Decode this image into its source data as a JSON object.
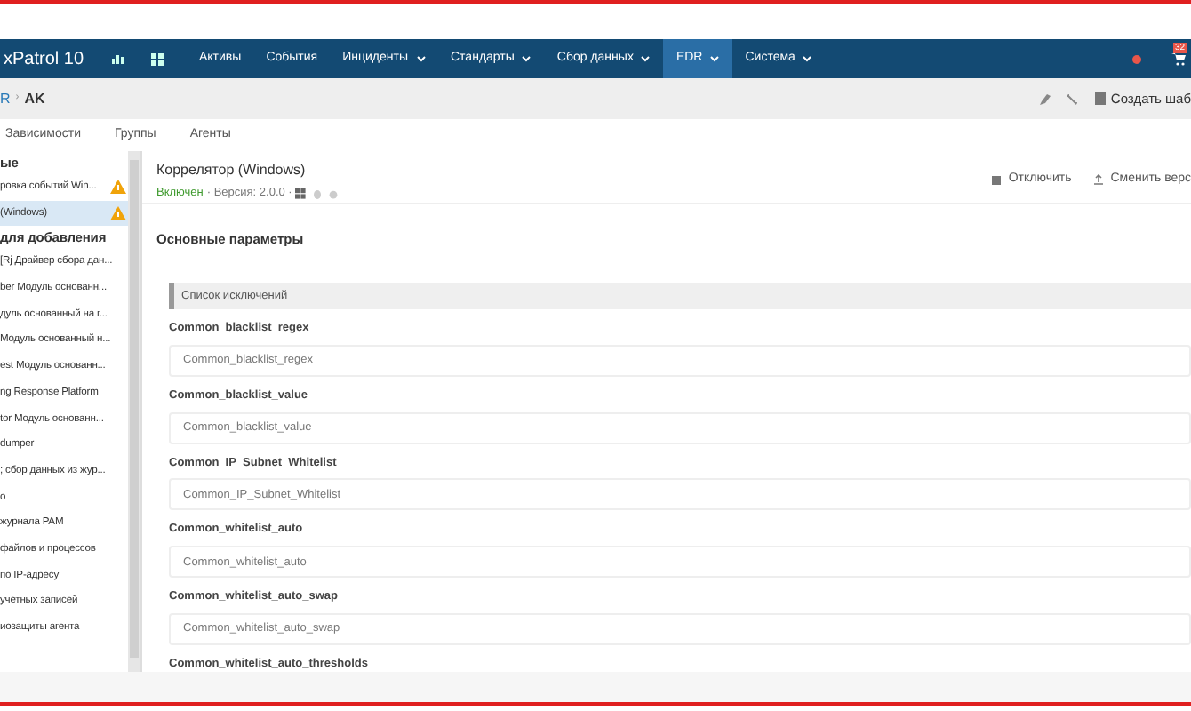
{
  "nav": {
    "logo": "xPatrol 10",
    "items": [
      {
        "label": "Активы",
        "dropdown": false,
        "selected": false
      },
      {
        "label": "События",
        "dropdown": false,
        "selected": false
      },
      {
        "label": "Инциденты",
        "dropdown": true,
        "selected": false
      },
      {
        "label": "Стандарты",
        "dropdown": true,
        "selected": false
      },
      {
        "label": "Сбор данных",
        "dropdown": true,
        "selected": false
      },
      {
        "label": "EDR",
        "dropdown": true,
        "selected": true
      },
      {
        "label": "Система",
        "dropdown": true,
        "selected": false
      }
    ],
    "notification_count": "32"
  },
  "breadcrumb": {
    "parent": "R",
    "separator": "›",
    "current": "AK",
    "create_label": "Создать шаб"
  },
  "tabs": [
    {
      "label": "Зависимости",
      "selected": false
    },
    {
      "label": "Группы",
      "selected": false
    },
    {
      "label": "Агенты",
      "selected": false
    }
  ],
  "sidebar": {
    "items": [
      {
        "kind": "header",
        "label": "ые"
      },
      {
        "kind": "item",
        "label": "ровка событий Win...",
        "warning": true,
        "selected": false
      },
      {
        "kind": "item",
        "label": "(Windows)",
        "warning": true,
        "selected": true
      },
      {
        "kind": "header",
        "label": "для добавления"
      },
      {
        "kind": "item",
        "label": "[Rj Драйвер сбора дан...",
        "warning": false,
        "selected": false
      },
      {
        "kind": "item",
        "label": "ber Модуль основанн...",
        "warning": false,
        "selected": false
      },
      {
        "kind": "item",
        "label": "дуль основанный на г...",
        "warning": false,
        "selected": false
      },
      {
        "kind": "item",
        "label": "Модуль основанный н...",
        "warning": false,
        "selected": false
      },
      {
        "kind": "item",
        "label": "est Модуль основанн...",
        "warning": false,
        "selected": false
      },
      {
        "kind": "item",
        "label": "ng Response Platform",
        "warning": false,
        "selected": false
      },
      {
        "kind": "item",
        "label": "tor Модуль основанн...",
        "warning": false,
        "selected": false
      },
      {
        "kind": "item",
        "label": "dumper",
        "warning": false,
        "selected": false
      },
      {
        "kind": "item",
        "label": "; сбор данных из жур...",
        "warning": false,
        "selected": false
      },
      {
        "kind": "item",
        "label": "о",
        "warning": false,
        "selected": false
      },
      {
        "kind": "item",
        "label": "журнала PAM",
        "warning": false,
        "selected": false
      },
      {
        "kind": "item",
        "label": "файлов и процессов",
        "warning": false,
        "selected": false
      },
      {
        "kind": "item",
        "label": "по IP-адресу",
        "warning": false,
        "selected": false
      },
      {
        "kind": "item",
        "label": "учетных записей",
        "warning": false,
        "selected": false
      },
      {
        "kind": "item",
        "label": "иозащиты агента",
        "warning": false,
        "selected": false
      }
    ]
  },
  "module": {
    "title": "Коррелятор (Windows)",
    "status": "Включен",
    "enabled": true,
    "version": "· Версия: 2.0.0 ·",
    "actions": [
      {
        "kind": "disable",
        "label": "Отключить"
      },
      {
        "kind": "upload",
        "label": "Сменить верс"
      }
    ]
  },
  "section": {
    "title": "Основные параметры",
    "group": "Список исключений",
    "fields": [
      {
        "label": "Common_blacklist_regex",
        "placeholder": "Common_blacklist_regex"
      },
      {
        "label": "Common_blacklist_value",
        "placeholder": "Common_blacklist_value"
      },
      {
        "label": "Common_IP_Subnet_Whitelist",
        "placeholder": "Common_IP_Subnet_Whitelist"
      },
      {
        "label": "Common_whitelist_auto",
        "placeholder": "Common_whitelist_auto"
      },
      {
        "label": "Common_whitelist_auto_swap",
        "placeholder": "Common_whitelist_auto_swap"
      },
      {
        "label": "Common_whitelist_auto_thresholds"
      }
    ]
  }
}
